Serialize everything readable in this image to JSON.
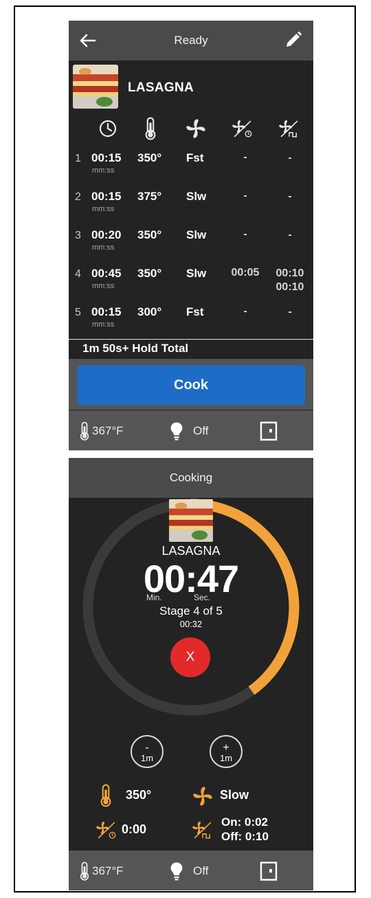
{
  "ready_screen": {
    "title": "Ready",
    "recipe": "LASAGNA",
    "columns": [
      "time-icon",
      "thermometer-icon",
      "fan-icon",
      "fan-cycle-icon",
      "fan-pulse-icon"
    ],
    "stages": [
      {
        "num": "1",
        "time": "00:15",
        "unit": "mm:ss",
        "temp": "350°",
        "fan": "Fst",
        "cycle": "-",
        "pulse": "-"
      },
      {
        "num": "2",
        "time": "00:15",
        "unit": "mm:ss",
        "temp": "375°",
        "fan": "Slw",
        "cycle": "-",
        "pulse": "-"
      },
      {
        "num": "3",
        "time": "00:20",
        "unit": "mm:ss",
        "temp": "350°",
        "fan": "Slw",
        "cycle": "-",
        "pulse": "-"
      },
      {
        "num": "4",
        "time": "00:45",
        "unit": "mm:ss",
        "temp": "350°",
        "fan": "Slw",
        "cycle": "00:05",
        "pulse_on": "00:10",
        "pulse_off": "00:10"
      },
      {
        "num": "5",
        "time": "00:15",
        "unit": "mm:ss",
        "temp": "300°",
        "fan": "Fst",
        "cycle": "-",
        "pulse": "-"
      }
    ],
    "total": "1m 50s+ Hold  Total",
    "cook_label": "Cook",
    "status": {
      "oven_temp": "367°F",
      "light": "Off"
    }
  },
  "cooking_screen": {
    "title": "Cooking",
    "recipe": "LASAGNA",
    "countdown": "00:47",
    "min_label": "Min.",
    "sec_label": "Sec.",
    "stage": "Stage 4 of 5",
    "stage_time": "00:32",
    "stop_label": "X",
    "progress": 0.4,
    "minus_sign": "-",
    "plus_sign": "+",
    "adjust_amount": "1m",
    "temp": "350°",
    "fan": "Slow",
    "cycle": "0:00",
    "pulse_on": "On: 0:02",
    "pulse_off": "Off: 0:10",
    "status": {
      "oven_temp": "367°F",
      "light": "Off"
    }
  },
  "colors": {
    "accent_orange": "#f2a23a",
    "cook_blue": "#1d6cc5",
    "stop_red": "#e22a2a",
    "panel": "#232323",
    "bar": "#555555"
  }
}
